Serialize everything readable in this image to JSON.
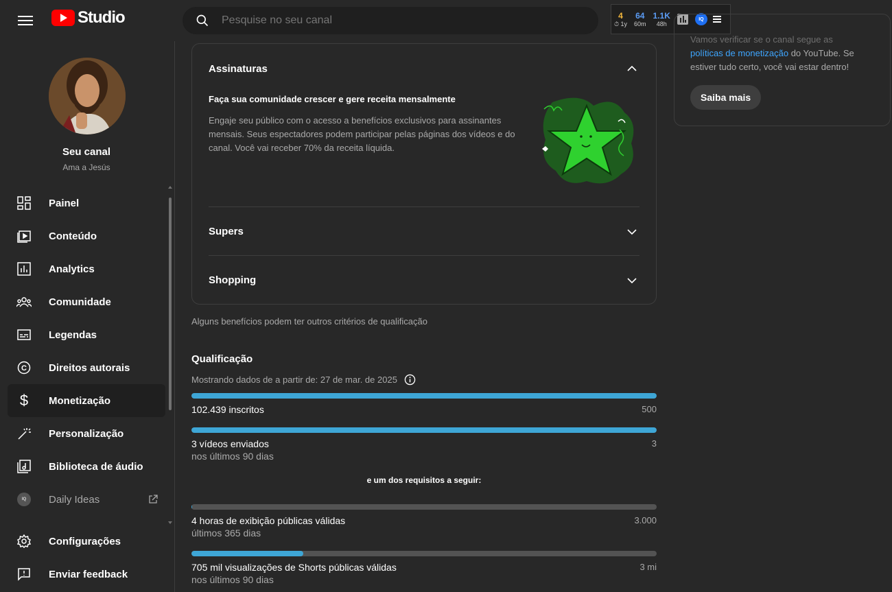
{
  "topbar": {
    "logo_text": "Studio",
    "search_placeholder": "Pesquise no seu canal",
    "extension": {
      "stats": [
        {
          "value": "4",
          "label": "⏱ 1y",
          "color": "#f2b63c"
        },
        {
          "value": "64",
          "label": "60m",
          "color": "#5b9cf5"
        },
        {
          "value": "1.1K",
          "label": "48h",
          "color": "#5b9cf5"
        }
      ],
      "badge": "IQ"
    }
  },
  "sidebar": {
    "channel_name": "Seu canal",
    "channel_sub": "Ama a Jesús",
    "items": [
      {
        "label": "Painel",
        "icon": "dashboard-icon"
      },
      {
        "label": "Conteúdo",
        "icon": "content-icon"
      },
      {
        "label": "Analytics",
        "icon": "analytics-icon"
      },
      {
        "label": "Comunidade",
        "icon": "community-icon"
      },
      {
        "label": "Legendas",
        "icon": "subtitles-icon"
      },
      {
        "label": "Direitos autorais",
        "icon": "copyright-icon"
      },
      {
        "label": "Monetização",
        "icon": "dollar-icon"
      },
      {
        "label": "Personalização",
        "icon": "magic-wand-icon"
      },
      {
        "label": "Biblioteca de áudio",
        "icon": "audio-library-icon"
      },
      {
        "label": "Daily Ideas",
        "icon": "daily-ideas-icon"
      }
    ],
    "bottom": [
      {
        "label": "Configurações",
        "icon": "gear-icon"
      },
      {
        "label": "Enviar feedback",
        "icon": "feedback-icon"
      }
    ],
    "daily_badge": "IQ"
  },
  "benefits": {
    "sections": [
      {
        "title": "Assinaturas",
        "expanded": true
      },
      {
        "title": "Supers",
        "expanded": false
      },
      {
        "title": "Shopping",
        "expanded": false
      }
    ],
    "subscriptions_headline": "Faça sua comunidade crescer e gere receita mensalmente",
    "subscriptions_desc": "Engaje seu público com o acesso a benefícios exclusivos para assinantes mensais. Seus espectadores podem participar pelas páginas dos vídeos e do canal. Você vai receber 70% da receita líquida.",
    "note": "Alguns benefícios podem ter outros critérios de qualificação"
  },
  "qualification": {
    "title": "Qualificação",
    "subtitle": "Mostrando dados de a partir de: 27 de mar. de 2025",
    "requirements": [
      {
        "label": "102.439 inscritos",
        "target": "500",
        "sub": "",
        "progress": 1.0
      },
      {
        "label": "3 vídeos enviados",
        "target": "3",
        "sub": "nos últimos 90 dias",
        "progress": 1.0
      }
    ],
    "or_text": "e um dos requisitos a seguir:",
    "alternatives": [
      {
        "label": "4 horas de exibição públicas válidas",
        "target": "3.000",
        "sub": "últimos 365 dias",
        "progress": 0.0013
      },
      {
        "label": "705 mil visualizações de Shorts públicas válidas",
        "target": "3 mi",
        "sub": "nos últimos 90 dias",
        "progress": 0.24
      }
    ],
    "bar_color": "#3ea6d6"
  },
  "right_panel": {
    "text_top": "Vamos verificar se o canal segue as",
    "link": "políticas de monetização",
    "text_after": " do YouTube. Se estiver tudo certo, você vai estar dentro!",
    "button": "Saiba mais"
  }
}
